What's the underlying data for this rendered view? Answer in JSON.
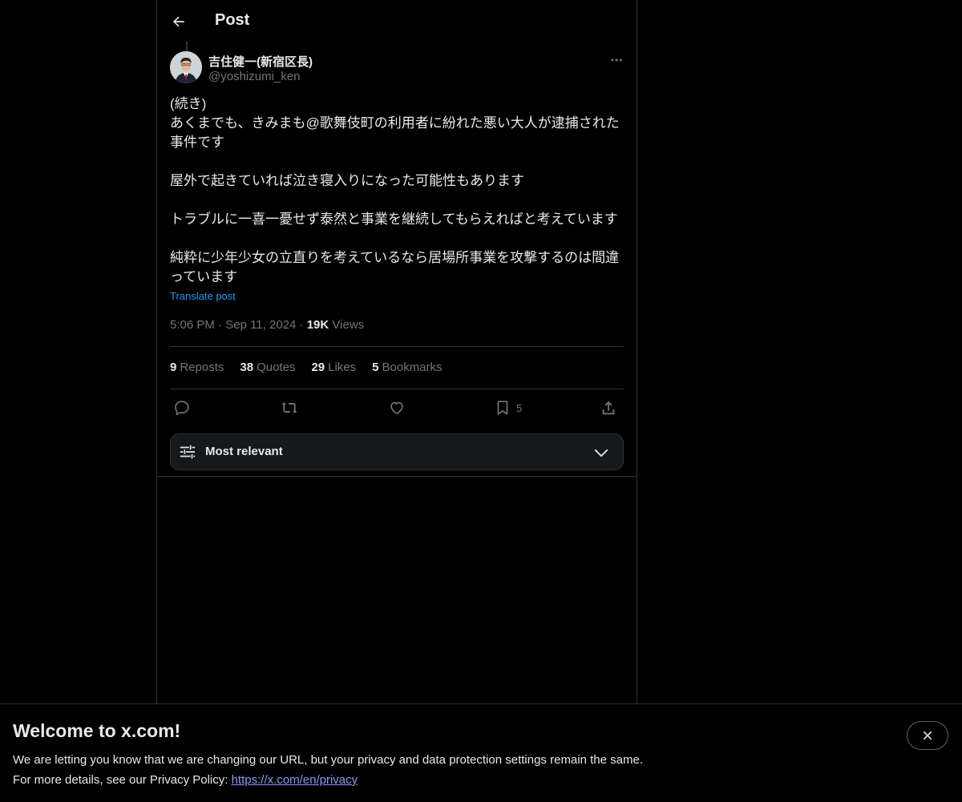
{
  "header": {
    "title": "Post"
  },
  "author": {
    "name": "吉住健一(新宿区長)",
    "handle": "@yoshizumi_ken"
  },
  "post": {
    "paragraphs": [
      "(続き)\nあくまでも、きみまも@歌舞伎町の利用者に紛れた悪い大人が逮捕された事件です",
      "屋外で起きていれば泣き寝入りになった可能性もあります",
      "トラブルに一喜一憂せず泰然と事業を継続してもらえればと考えています",
      "純粋に少年少女の立直りを考えているなら居場所事業を攻撃するのは間違っています"
    ],
    "translate_label": "Translate post",
    "time": "5:06 PM",
    "date": "Sep 11, 2024",
    "views_count": "19K",
    "views_label": "Views"
  },
  "stats": [
    {
      "count": "9",
      "label": "Reposts"
    },
    {
      "count": "38",
      "label": "Quotes"
    },
    {
      "count": "29",
      "label": "Likes"
    },
    {
      "count": "5",
      "label": "Bookmarks"
    }
  ],
  "actions": {
    "bookmark_count": "5",
    "icons": [
      "reply-icon",
      "repost-icon",
      "like-icon",
      "bookmark-icon",
      "share-icon"
    ]
  },
  "sort": {
    "label": "Most relevant"
  },
  "banner": {
    "title": "Welcome to x.com!",
    "line1": "We are letting you know that we are changing our URL, but your privacy and data protection settings remain the same.",
    "line2_prefix": "For more details, see our Privacy Policy: ",
    "link": "https://x.com/en/privacy"
  },
  "colors": {
    "background": "#000000",
    "text": "#e7e9ea",
    "muted": "#71767b",
    "border": "#2f3336",
    "link": "#1d9bf0"
  }
}
